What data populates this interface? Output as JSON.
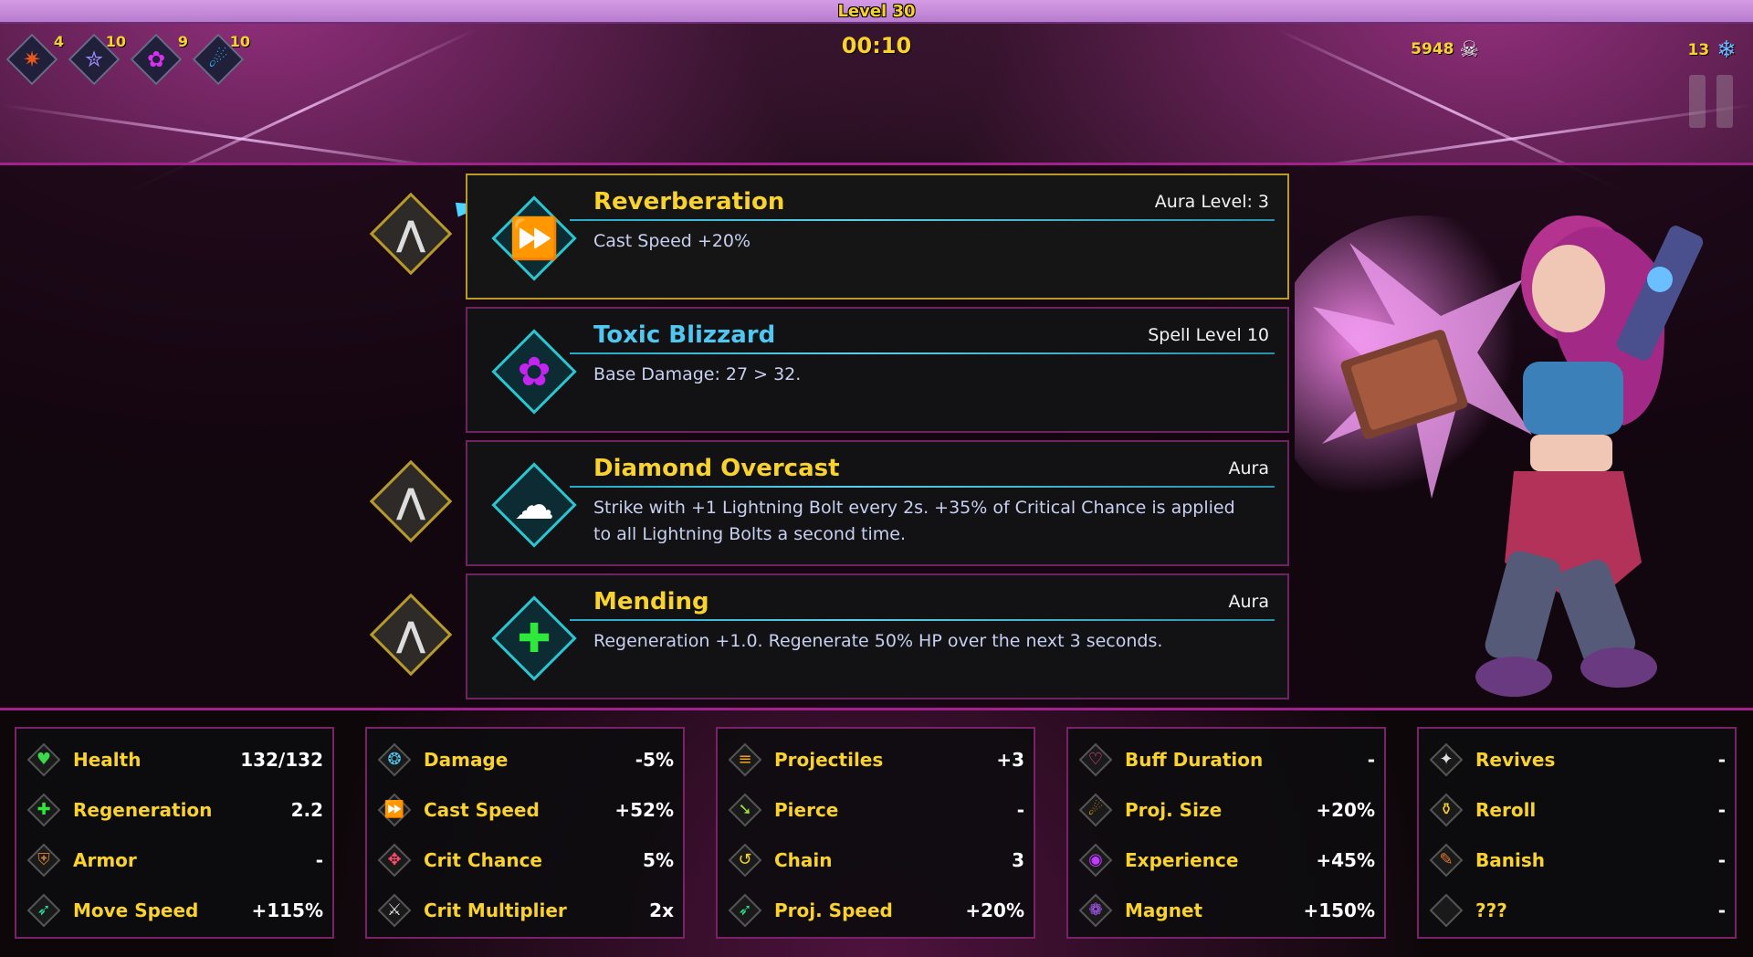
{
  "header": {
    "level_label": "Level 30",
    "timer": "00:10",
    "kills": "5948",
    "gems": "13"
  },
  "hud_icons": [
    {
      "name": "burst-icon",
      "glyph": "✷",
      "count": "4",
      "color": "#e8581c"
    },
    {
      "name": "star-icon",
      "glyph": "✮",
      "count": "10",
      "color": "#9d8cff"
    },
    {
      "name": "flower-icon",
      "glyph": "✿",
      "count": "9",
      "color": "#d830f0"
    },
    {
      "name": "fireball-icon",
      "glyph": "☄",
      "count": "10",
      "color": "#30b8ff"
    }
  ],
  "upgrades": [
    {
      "title": "Reverberation",
      "tag": "Aura Level: 3",
      "desc": "Cast Speed +20%",
      "icon": "fast-forward-icon",
      "glyph": "⏩",
      "glyph_color": "#f9d22d",
      "title_color": "yellow",
      "selected": true
    },
    {
      "title": "Toxic Blizzard",
      "tag": "Spell Level 10",
      "desc": "Base Damage: 27 > 32.",
      "icon": "flower-icon",
      "glyph": "✿",
      "glyph_color": "#c324f0",
      "title_color": "cyan",
      "selected": false
    },
    {
      "title": "Diamond Overcast",
      "tag": "Aura",
      "desc": "Strike with +1 Lightning Bolt every 2s. +35% of Critical Chance is applied to all Lightning Bolts a second time.",
      "icon": "cloud-icon",
      "glyph": "☁",
      "glyph_color": "#ffffff",
      "title_color": "yellow",
      "selected": false
    },
    {
      "title": "Mending",
      "tag": "Aura",
      "desc": "Regeneration +1.0. Regenerate 50% HP over the next 3 seconds.",
      "icon": "plus-icon",
      "glyph": "✚",
      "glyph_color": "#2ee83c",
      "title_color": "yellow",
      "selected": false
    }
  ],
  "stats": [
    [
      {
        "label": "Health",
        "value": "132/132",
        "icon": "heart-icon",
        "glyph": "♥",
        "color": "#3ad84a"
      },
      {
        "label": "Regeneration",
        "value": "2.2",
        "icon": "plus-icon",
        "glyph": "✚",
        "color": "#2ee83c"
      },
      {
        "label": "Armor",
        "value": "-",
        "icon": "shield-icon",
        "glyph": "⛨",
        "color": "#c57a30"
      },
      {
        "label": "Move Speed",
        "value": "+115%",
        "icon": "wing-icon",
        "glyph": "➶",
        "color": "#2ee0a0"
      }
    ],
    [
      {
        "label": "Damage",
        "value": "-5%",
        "icon": "brain-icon",
        "glyph": "❂",
        "color": "#4fc7f0"
      },
      {
        "label": "Cast Speed",
        "value": "+52%",
        "icon": "fast-forward-icon",
        "glyph": "⏩",
        "color": "#f9d22d"
      },
      {
        "label": "Crit Chance",
        "value": "5%",
        "icon": "target-icon",
        "glyph": "✥",
        "color": "#ff4a6a"
      },
      {
        "label": "Crit Multiplier",
        "value": "2x",
        "icon": "swords-icon",
        "glyph": "⚔",
        "color": "#e0e0e0"
      }
    ],
    [
      {
        "label": "Projectiles",
        "value": "+3",
        "icon": "arrows-icon",
        "glyph": "≡",
        "color": "#f0a020"
      },
      {
        "label": "Pierce",
        "value": "-",
        "icon": "arrow-down-right-icon",
        "glyph": "➘",
        "color": "#a0e030"
      },
      {
        "label": "Chain",
        "value": "3",
        "icon": "hook-icon",
        "glyph": "↺",
        "color": "#f9d22d"
      },
      {
        "label": "Proj. Speed",
        "value": "+20%",
        "icon": "feather-icon",
        "glyph": "➶",
        "color": "#30e090"
      }
    ],
    [
      {
        "label": "Buff Duration",
        "value": "-",
        "icon": "heart-pulse-icon",
        "glyph": "♡",
        "color": "#ff4aa0"
      },
      {
        "label": "Proj. Size",
        "value": "+20%",
        "icon": "comet-icon",
        "glyph": "☄",
        "color": "#f0a020"
      },
      {
        "label": "Experience",
        "value": "+45%",
        "icon": "orb-icon",
        "glyph": "◉",
        "color": "#c03aff"
      },
      {
        "label": "Magnet",
        "value": "+150%",
        "icon": "swirl-icon",
        "glyph": "❁",
        "color": "#b35aff"
      }
    ],
    [
      {
        "label": "Revives",
        "value": "-",
        "icon": "phoenix-icon",
        "glyph": "✦",
        "color": "#e0e0e0"
      },
      {
        "label": "Reroll",
        "value": "-",
        "icon": "potion-icon",
        "glyph": "⚱",
        "color": "#f9d22d"
      },
      {
        "label": "Banish",
        "value": "-",
        "icon": "dagger-icon",
        "glyph": "✎",
        "color": "#e07830"
      },
      {
        "label": "???",
        "value": "-",
        "icon": "empty-slot-icon",
        "glyph": "",
        "color": "#888888"
      }
    ]
  ]
}
